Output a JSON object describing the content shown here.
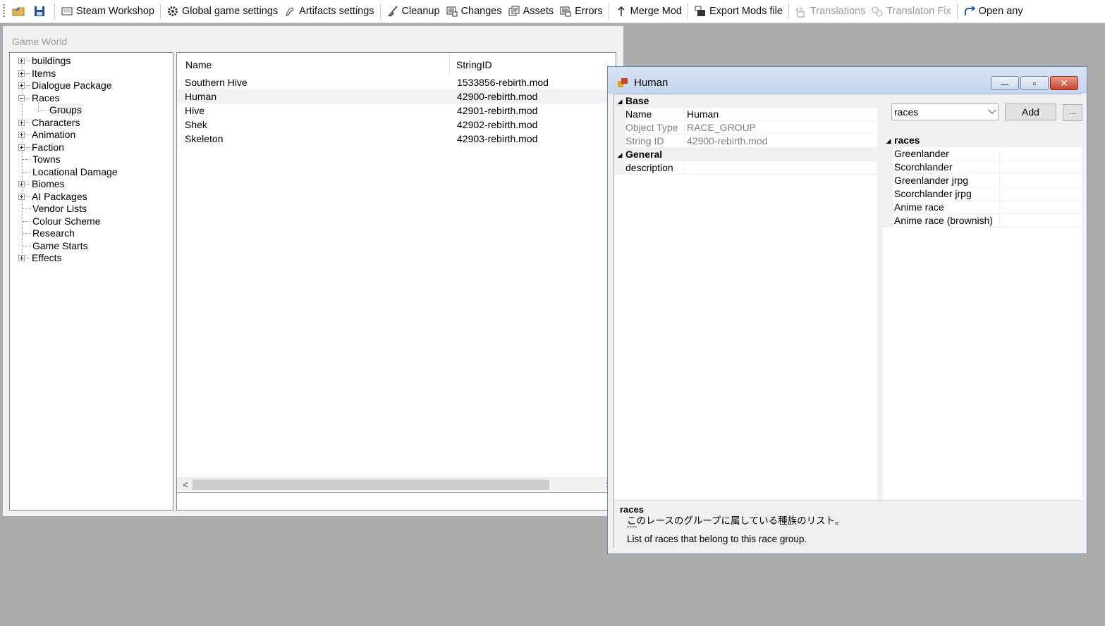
{
  "toolbar": {
    "items": [
      {
        "label": "",
        "icon": "open-folder-icon"
      },
      {
        "label": "",
        "icon": "save-icon"
      },
      {
        "label": "Steam Workshop",
        "icon": "workshop-icon"
      },
      {
        "label": "Global game settings",
        "icon": "gear-icon"
      },
      {
        "label": "Artifacts settings",
        "icon": "artifact-icon"
      },
      {
        "label": "Cleanup",
        "icon": "broom-icon"
      },
      {
        "label": "Changes",
        "icon": "changes-icon"
      },
      {
        "label": "Assets",
        "icon": "assets-icon"
      },
      {
        "label": "Errors",
        "icon": "errors-icon"
      },
      {
        "label": "Merge Mod",
        "icon": "merge-icon"
      },
      {
        "label": "Export Mods file",
        "icon": "export-icon"
      },
      {
        "label": "Translations",
        "icon": "translations-icon"
      },
      {
        "label": "Translaton Fix",
        "icon": "translation-fix-icon"
      },
      {
        "label": "Open any",
        "icon": "open-any-icon"
      }
    ]
  },
  "game_world": {
    "title": "Game World",
    "tree": [
      {
        "label": "buildings",
        "expander": "plus"
      },
      {
        "label": "Items",
        "expander": "plus"
      },
      {
        "label": "Dialogue Package",
        "expander": "plus"
      },
      {
        "label": "Races",
        "expander": "minus"
      },
      {
        "label": "Groups",
        "expander": "none",
        "child": true,
        "selected": true
      },
      {
        "label": "Characters",
        "expander": "plus"
      },
      {
        "label": "Animation",
        "expander": "plus"
      },
      {
        "label": "Faction",
        "expander": "plus"
      },
      {
        "label": "Towns",
        "expander": "none"
      },
      {
        "label": "Locational Damage",
        "expander": "none"
      },
      {
        "label": "Biomes",
        "expander": "plus"
      },
      {
        "label": "AI Packages",
        "expander": "plus"
      },
      {
        "label": "Vendor Lists",
        "expander": "none"
      },
      {
        "label": "Colour Scheme",
        "expander": "none"
      },
      {
        "label": "Research",
        "expander": "none"
      },
      {
        "label": "Game Starts",
        "expander": "none"
      },
      {
        "label": "Effects",
        "expander": "plus"
      }
    ],
    "list": {
      "columns": [
        "Name",
        "StringID"
      ],
      "rows": [
        {
          "name": "Southern Hive",
          "string_id": "1533856-rebirth.mod",
          "selected": false
        },
        {
          "name": "Human",
          "string_id": "42900-rebirth.mod",
          "selected": true
        },
        {
          "name": "Hive",
          "string_id": "42901-rebirth.mod",
          "selected": false
        },
        {
          "name": "Shek",
          "string_id": "42902-rebirth.mod",
          "selected": false
        },
        {
          "name": "Skeleton",
          "string_id": "42903-rebirth.mod",
          "selected": false
        }
      ],
      "scroll_left": "<",
      "scroll_right": ">"
    }
  },
  "human_window": {
    "title": "Human",
    "controls": {
      "minimize": "—",
      "maximize": "▫",
      "close": "✕"
    },
    "categories": {
      "base": "Base",
      "general": "General"
    },
    "base_props": [
      {
        "key": "Name",
        "value": "Human",
        "readonly": false
      },
      {
        "key": "Object Type",
        "value": "RACE_GROUP",
        "readonly": true
      },
      {
        "key": "String ID",
        "value": "42900-rebirth.mod",
        "readonly": true
      }
    ],
    "general_props": [
      {
        "key": "description",
        "value": "",
        "readonly": false
      }
    ],
    "list_combo": {
      "selected": "races"
    },
    "add_button": "Add",
    "more_button": "...",
    "races_category": "races",
    "races": [
      "Greenlander",
      "Scorchlander",
      "Greenlander jrpg",
      "Scorchlander jrpg",
      "Anime race",
      "Anime race (brownish)"
    ],
    "help": {
      "title": "races",
      "line1": "このレースのグループに属している種族のリスト。",
      "line2": "----",
      "line3": "List of races that belong to this race group."
    }
  },
  "colors": {
    "desktop": "#ababab",
    "titlebar": "#d6e3f4",
    "close_button": "#c8452f",
    "selected_row": "#f2f2f2"
  }
}
